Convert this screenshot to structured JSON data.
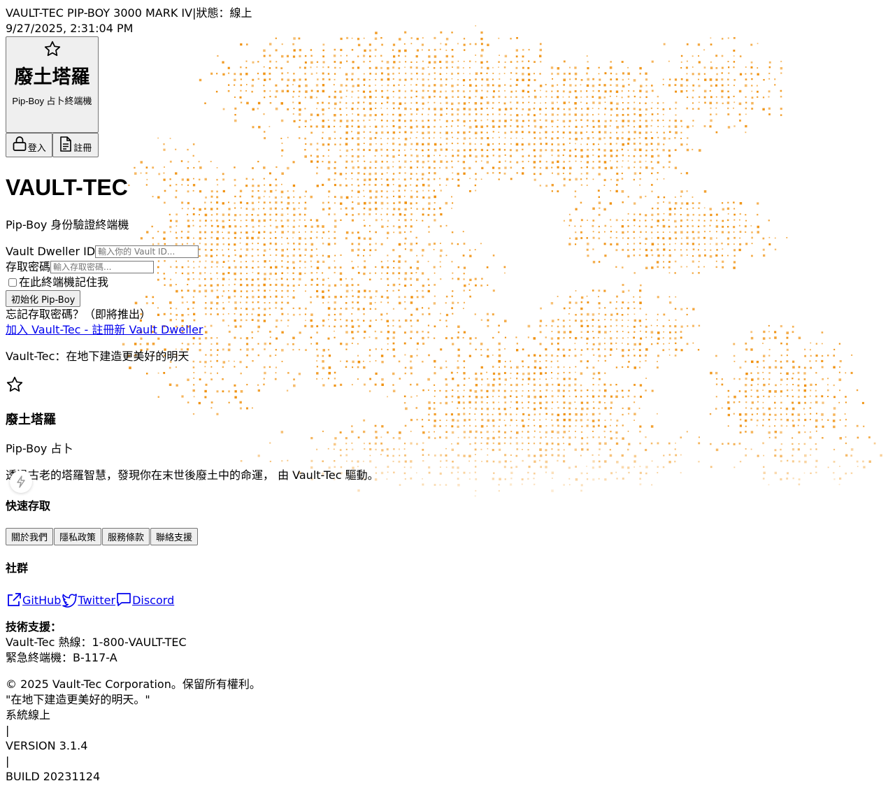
{
  "status_bar": {
    "system": "VAULT-TEC PIP-BOY 3000 MARK IV",
    "status": "|狀態：線上",
    "datetime": "9/27/2025, 2:31:04 PM"
  },
  "brand_button": {
    "icon": "star-icon",
    "title": "廢土塔羅",
    "subtitle": "Pip-Boy 占卜終端機"
  },
  "auth": {
    "login_icon": "lock-icon",
    "login_label": "登入",
    "register_icon": "document-icon",
    "register_label": "註冊"
  },
  "login_panel": {
    "heading": "VAULT-TEC",
    "tagline": "Pip-Boy 身份驗證終端機",
    "dweller_label": "Vault Dweller ID",
    "dweller_placeholder": "輸入你的 Vault ID...",
    "password_label": "存取密碼",
    "password_placeholder": "輸入存取密碼...",
    "remember_label": "在此終端機記住我",
    "submit_label": "初始化 Pip-Boy",
    "forgot_text": "忘記存取密碼？（即將推出）",
    "join_link": "加入 Vault-Tec - 註冊新 Vault Dweller",
    "motto": "Vault-Tec：在地下建造更美好的明天"
  },
  "footer": {
    "brand_icon": "star-icon",
    "brand_title": "廢土塔羅",
    "brand_sub": "Pip-Boy 占卜",
    "description": "透過古老的塔羅智慧，發現你在末世後廢土中的命運， 由 Vault-Tec 驅動。",
    "quick_heading": "快速存取",
    "quick_links": [
      "關於我們",
      "隱私政策",
      "服務條款",
      "聯絡支援"
    ],
    "social_heading": "社群",
    "social_links": [
      {
        "icon": "external-link-icon",
        "label": "GitHub"
      },
      {
        "icon": "twitter-icon",
        "label": "Twitter"
      },
      {
        "icon": "chat-bubble-icon",
        "label": "Discord"
      }
    ],
    "support_heading": "技術支援：",
    "support_hotline": "Vault-Tec 熱線：1-800-VAULT-TEC",
    "support_terminal": "緊急終端機：B-117-A",
    "copyright": "© 2025 Vault-Tec Corporation。保留所有權利。",
    "quote": "\"在地下建造更美好的明天。\"",
    "system_status": "系統線上",
    "sep1": "|",
    "version": "VERSION 3.1.4",
    "sep2": "|",
    "build": "BUILD 20231124"
  },
  "floating_button_icon": "bolt-icon",
  "colors": {
    "pixel_accent": "#f0900c",
    "link": "#0000ee",
    "button_bg": "#efefef"
  }
}
